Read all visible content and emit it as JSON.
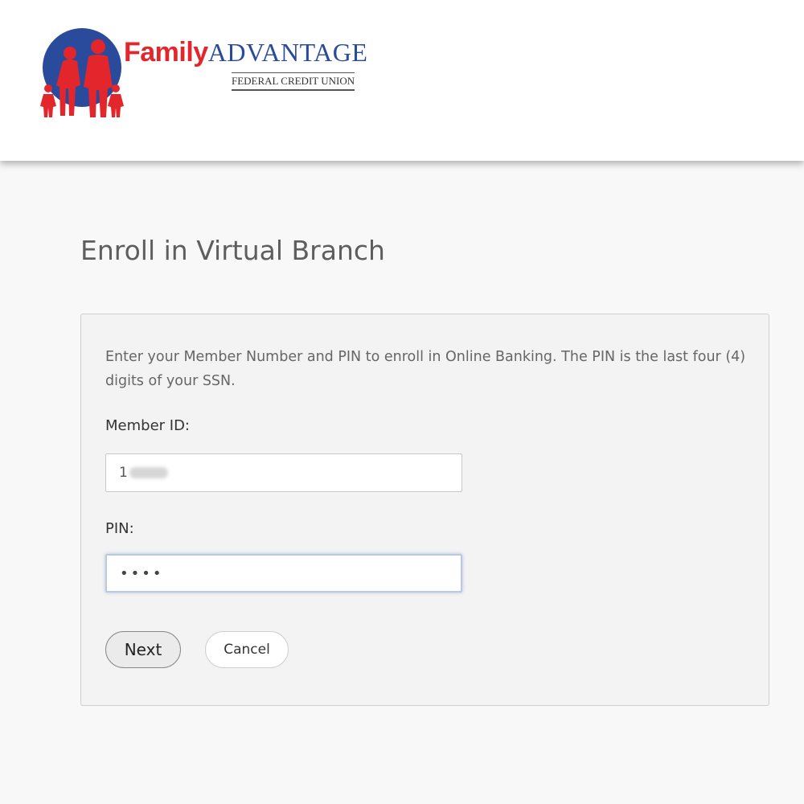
{
  "header": {
    "logo": {
      "word_family": "Family",
      "word_advantage": "ADVANTAGE",
      "subtitle": "FEDERAL CREDIT UNION",
      "colors": {
        "red": "#e3262c",
        "blue": "#2a4b9b"
      }
    }
  },
  "page": {
    "title": "Enroll in Virtual Branch"
  },
  "form": {
    "instructions": "Enter your Member Number and PIN to enroll in Online Banking. The PIN is the last four (4) digits of your SSN.",
    "member_id": {
      "label": "Member ID:",
      "value": "1"
    },
    "pin": {
      "label": "PIN:",
      "value": "••••"
    },
    "buttons": {
      "next": "Next",
      "cancel": "Cancel"
    }
  }
}
